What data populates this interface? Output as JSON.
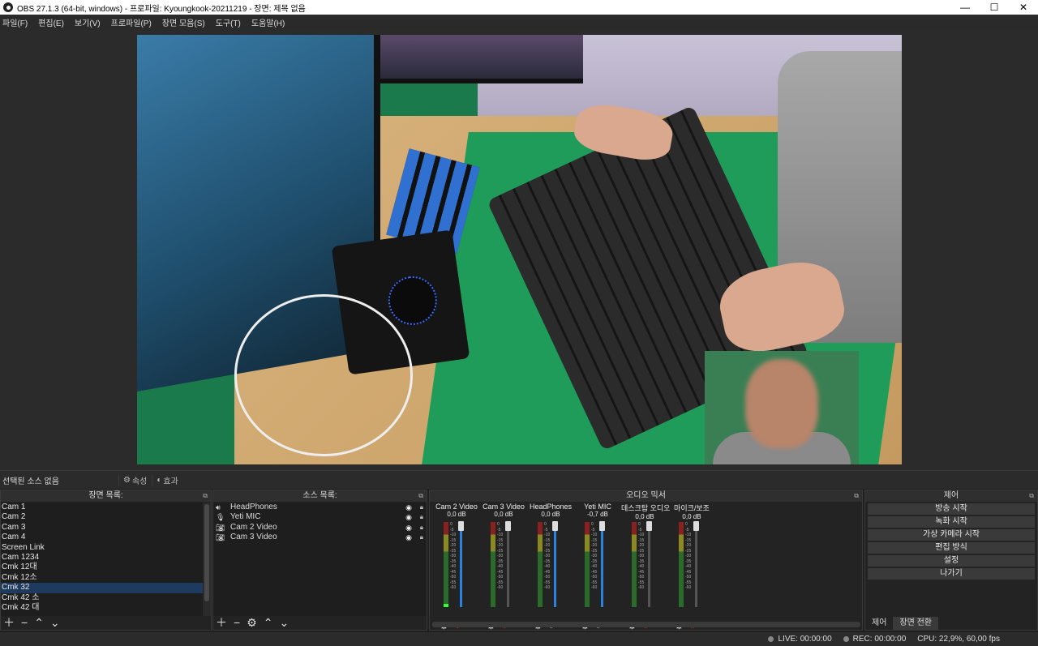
{
  "window": {
    "title": "OBS 27.1.3 (64-bit, windows) - 프로파일: Kyoungkook-20211219 - 장면: 제목 없음",
    "min": "—",
    "max": "☐",
    "close": "✕"
  },
  "menu": [
    "파일(F)",
    "편집(E)",
    "보기(V)",
    "프로파일(P)",
    "장면 모음(S)",
    "도구(T)",
    "도움말(H)"
  ],
  "source_status": {
    "no_source": "선택된 소스 없음",
    "properties": "속성",
    "filters": "효과"
  },
  "scenes": {
    "header": "장면 목록:",
    "items": [
      "Cam 1",
      "Cam 2",
      "Cam 3",
      "Cam 4",
      "Screen Link",
      "Cam 1234",
      "Cmk 12대",
      "Cmk 12소",
      "Cmk 32",
      "Cmk 42 소",
      "Cmk 42 대"
    ],
    "selected_index": 8
  },
  "sources": {
    "header": "소스 목록:",
    "items": [
      {
        "name": "HeadPhones",
        "icon": "speaker-icon"
      },
      {
        "name": "Yeti MIC",
        "icon": "microphone-icon"
      },
      {
        "name": "Cam 2 Video",
        "icon": "camera-icon"
      },
      {
        "name": "Cam 3 Video",
        "icon": "camera-icon"
      }
    ]
  },
  "mixer": {
    "header": "오디오 믹서",
    "scale": [
      "0",
      "-5",
      "-10",
      "-15",
      "-20",
      "-25",
      "-30",
      "-35",
      "-40",
      "-45",
      "-50",
      "-55",
      "-60"
    ],
    "channels": [
      {
        "name": "Cam 2 Video",
        "db": "0,0 dB",
        "muted": true,
        "active_fader": true
      },
      {
        "name": "Cam 3 Video",
        "db": "0,0 dB",
        "muted": true,
        "active_fader": false
      },
      {
        "name": "HeadPhones",
        "db": "0,0 dB",
        "muted": false,
        "active_fader": true
      },
      {
        "name": "Yeti MIC",
        "db": "-0,7 dB",
        "muted": false,
        "active_fader": true
      },
      {
        "name": "데스크탑 오디오",
        "db": "0,0 dB",
        "muted": true,
        "active_fader": false
      },
      {
        "name": "마이크/보조",
        "db": "0,0 dB",
        "muted": true,
        "active_fader": false
      }
    ]
  },
  "controls": {
    "header": "제어",
    "buttons": [
      "방송 시작",
      "녹화 시작",
      "가상 카메라 시작",
      "편집 방식",
      "설정",
      "나가기"
    ],
    "tabs": [
      "제어",
      "장면 전환"
    ]
  },
  "statusbar": {
    "live": "LIVE: 00:00:00",
    "rec": "REC: 00:00:00",
    "cpu": "CPU: 22,9%, 60,00 fps"
  }
}
